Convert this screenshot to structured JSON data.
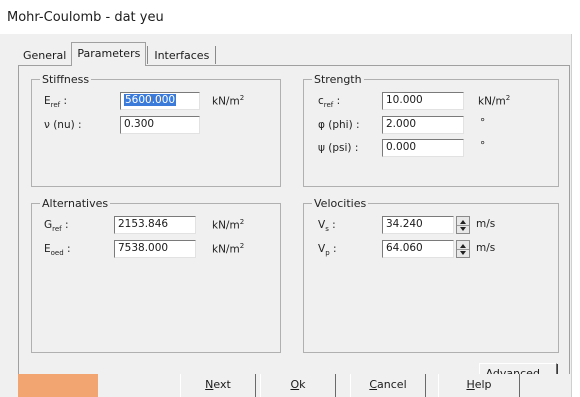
{
  "window": {
    "title": "Mohr-Coulomb - dat yeu"
  },
  "tabs": [
    {
      "label": "General"
    },
    {
      "label": "Parameters"
    },
    {
      "label": "Interfaces"
    }
  ],
  "stiffness": {
    "legend": "Stiffness",
    "eref": {
      "label_main": "E",
      "label_sub": "ref",
      "label_tail": " :",
      "value": "5600.000",
      "unit_main": "kN/m",
      "unit_sup": "2"
    },
    "nu": {
      "label": "ν (nu) :",
      "value": "0.300"
    }
  },
  "strength": {
    "legend": "Strength",
    "cref": {
      "label_main": "c",
      "label_sub": "ref",
      "label_tail": " :",
      "value": "10.000",
      "unit_main": "kN/m",
      "unit_sup": "2"
    },
    "phi": {
      "label": "φ (phi) :",
      "value": "2.000",
      "unit": "°"
    },
    "psi": {
      "label": "ψ (psi) :",
      "value": "0.000",
      "unit": "°"
    }
  },
  "alternatives": {
    "legend": "Alternatives",
    "gref": {
      "label_main": "G",
      "label_sub": "ref",
      "label_tail": " :",
      "value": "2153.846",
      "unit_main": "kN/m",
      "unit_sup": "2"
    },
    "eoed": {
      "label_main": "E",
      "label_sub": "oed",
      "label_tail": " :",
      "value": "7538.000",
      "unit_main": "kN/m",
      "unit_sup": "2"
    }
  },
  "velocities": {
    "legend": "Velocities",
    "vs": {
      "label_main": "V",
      "label_sub": "s",
      "label_tail": " :",
      "value": "34.240",
      "unit": "m/s"
    },
    "vp": {
      "label_main": "V",
      "label_sub": "p",
      "label_tail": " :",
      "value": "64.060",
      "unit": "m/s"
    }
  },
  "buttons": {
    "advanced": {
      "first": "A",
      "rest": "dvanced..."
    },
    "next": {
      "first": "N",
      "rest": "ext"
    },
    "ok": {
      "first": "O",
      "rest": "k"
    },
    "cancel": {
      "first": "C",
      "rest": "ancel"
    },
    "help": {
      "first": "H",
      "rest": "elp"
    }
  },
  "colors": {
    "selection": "#3b7ad8",
    "footer_accent": "#f2a571",
    "dialog_bg": "#f0f0f0"
  }
}
